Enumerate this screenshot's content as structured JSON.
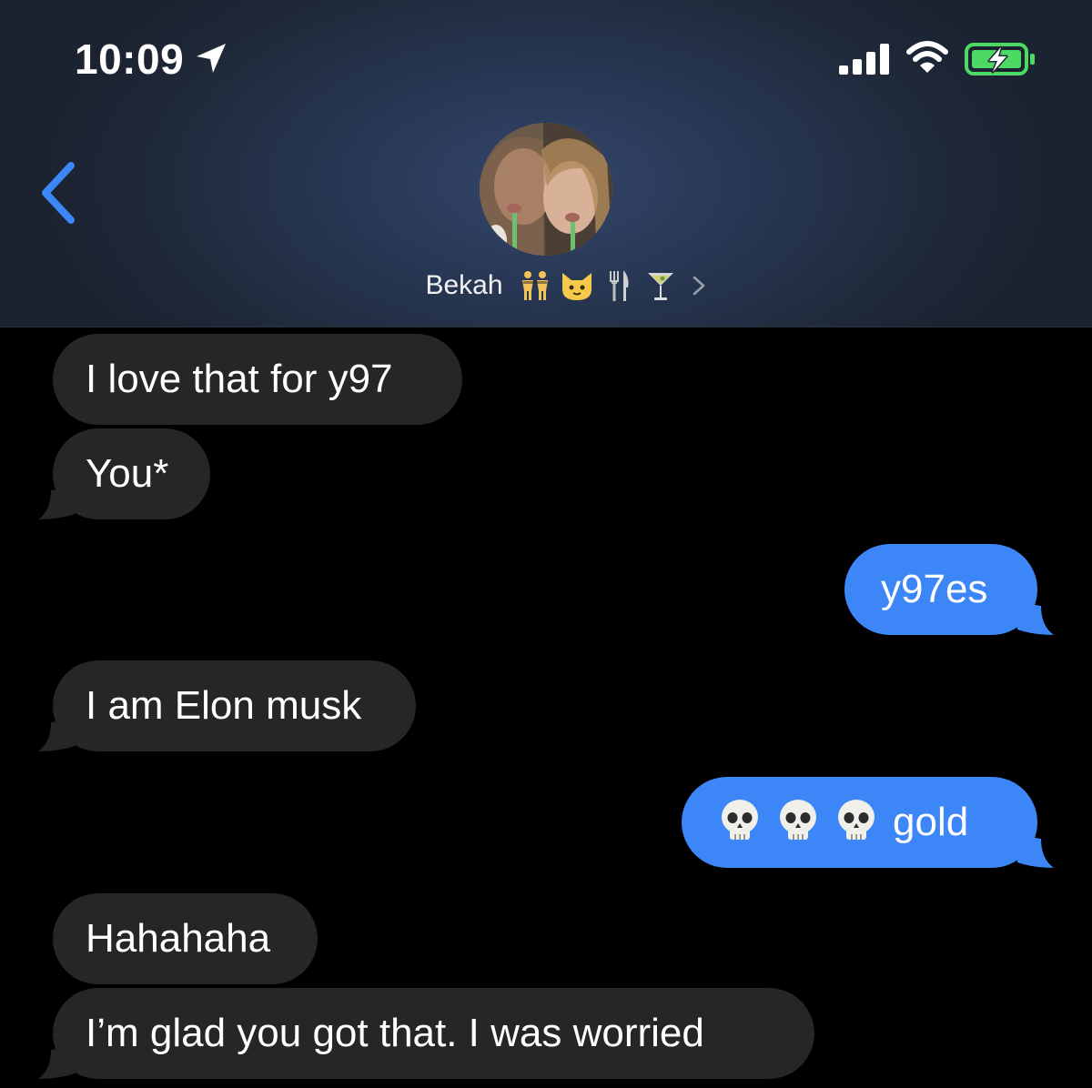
{
  "status_bar": {
    "time": "10:09",
    "icons": [
      "location-arrow-icon",
      "cellular-signal-icon",
      "wifi-icon",
      "battery-charging-icon"
    ]
  },
  "header": {
    "back_icon": "chevron-left-icon",
    "contact_name": "Bekah",
    "contact_emojis": [
      "dancing-women-emoji",
      "cat-face-emoji",
      "fork-and-knife-emoji",
      "cocktail-glass-emoji"
    ],
    "chevron_icon": "chevron-right-icon"
  },
  "messages": [
    {
      "side": "incoming",
      "text": "I love that for y97"
    },
    {
      "side": "incoming",
      "text": "You*"
    },
    {
      "side": "outgoing",
      "text": "y97es"
    },
    {
      "side": "incoming",
      "text": "I am Elon musk"
    },
    {
      "side": "outgoing",
      "emoji": [
        "skull-emoji",
        "skull-emoji",
        "skull-emoji"
      ],
      "text": "gold"
    },
    {
      "side": "incoming",
      "text": "Hahahaha"
    },
    {
      "side": "incoming",
      "text": "I’m glad you got that. I was worried"
    }
  ],
  "colors": {
    "incoming_bubble": "#262628",
    "outgoing_bubble": "#3d86f7",
    "accent_blue": "#3d86f7",
    "battery_green": "#4cd964",
    "background": "#000000"
  }
}
